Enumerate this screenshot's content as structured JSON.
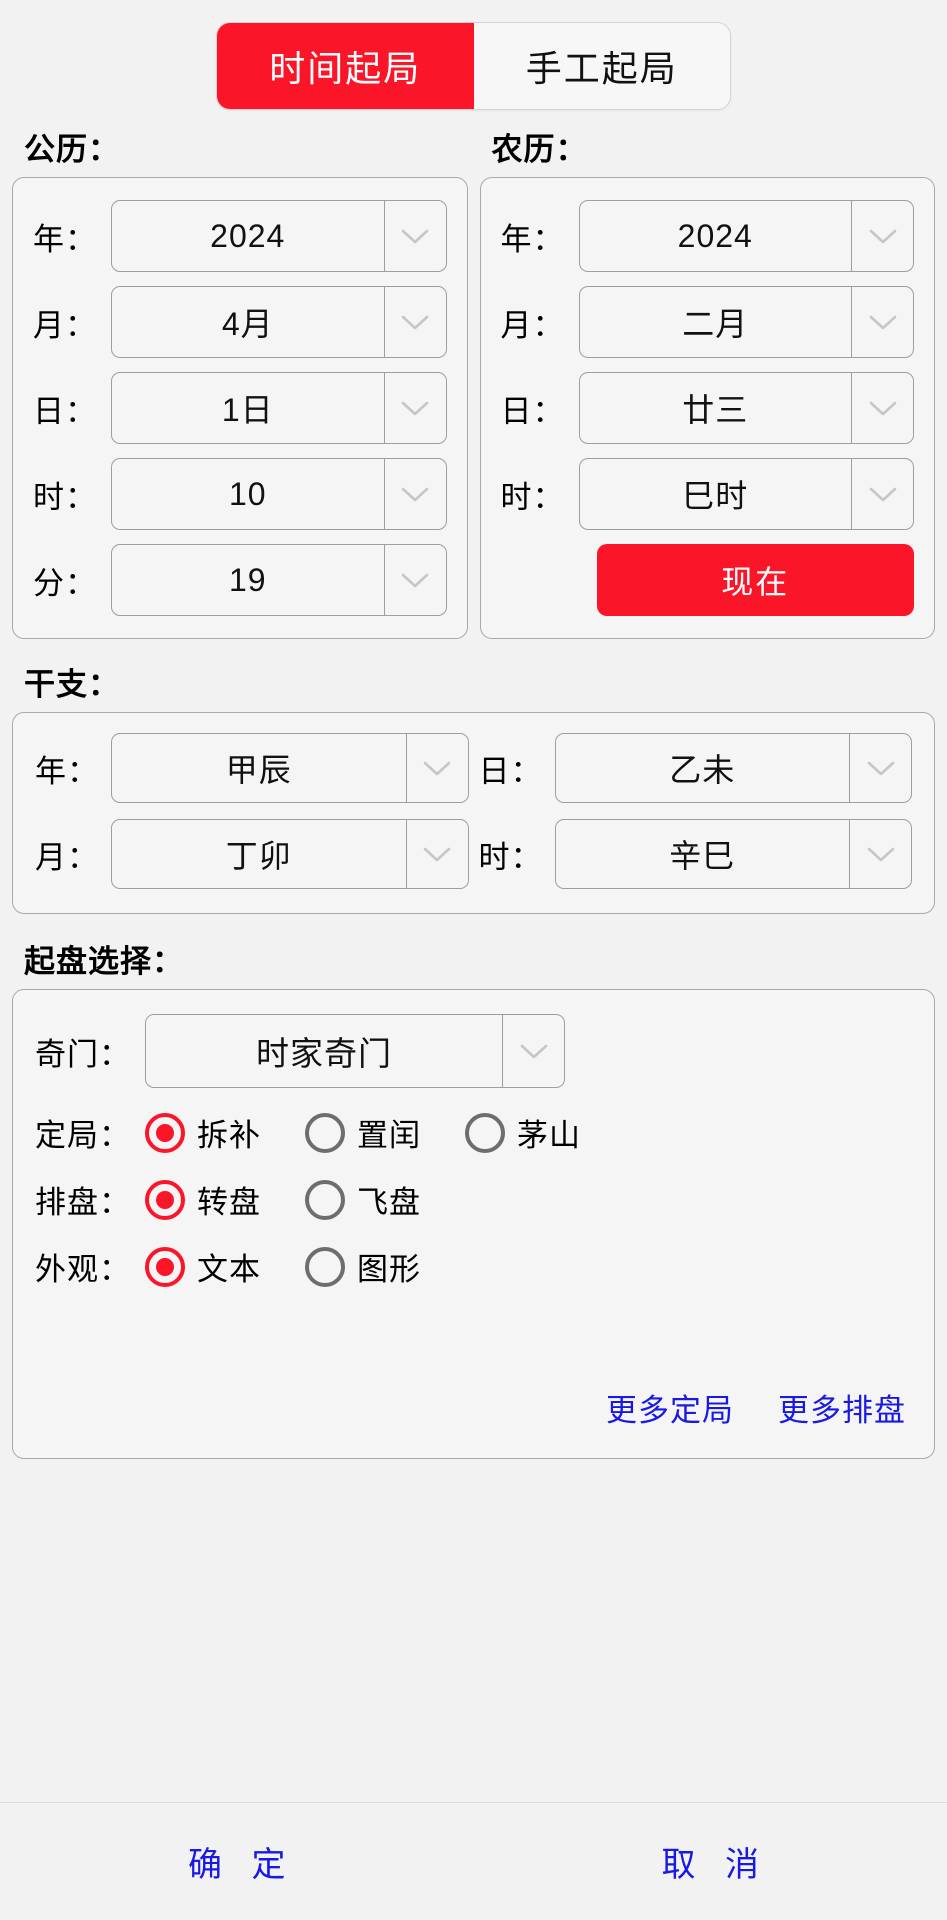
{
  "tabs": [
    {
      "label": "时间起局",
      "active": true
    },
    {
      "label": "手工起局",
      "active": false
    }
  ],
  "solar": {
    "title": "公历：",
    "fields": [
      {
        "label": "年：",
        "value": "2024"
      },
      {
        "label": "月：",
        "value": "4月"
      },
      {
        "label": "日：",
        "value": "1日"
      },
      {
        "label": "时：",
        "value": "10"
      },
      {
        "label": "分：",
        "value": "19"
      }
    ]
  },
  "lunar": {
    "title": "农历：",
    "fields": [
      {
        "label": "年：",
        "value": "2024"
      },
      {
        "label": "月：",
        "value": "二月"
      },
      {
        "label": "日：",
        "value": "廿三"
      },
      {
        "label": "时：",
        "value": "巳时"
      }
    ],
    "now_button": "现在"
  },
  "ganzhi": {
    "title": "干支：",
    "rows": [
      [
        {
          "label": "年：",
          "value": "甲辰"
        },
        {
          "label": "日：",
          "value": "乙未"
        }
      ],
      [
        {
          "label": "月：",
          "value": "丁卯"
        },
        {
          "label": "时：",
          "value": "辛巳"
        }
      ]
    ]
  },
  "plate": {
    "title": "起盘选择：",
    "qimen": {
      "label": "奇门：",
      "value": "时家奇门"
    },
    "radio_groups": [
      {
        "label": "定局：",
        "options": [
          {
            "text": "拆补",
            "checked": true
          },
          {
            "text": "置闰",
            "checked": false
          },
          {
            "text": "茅山",
            "checked": false
          }
        ]
      },
      {
        "label": "排盘：",
        "options": [
          {
            "text": "转盘",
            "checked": true
          },
          {
            "text": "飞盘",
            "checked": false
          }
        ]
      },
      {
        "label": "外观：",
        "options": [
          {
            "text": "文本",
            "checked": true
          },
          {
            "text": "图形",
            "checked": false
          }
        ]
      }
    ],
    "more_links": [
      {
        "text": "更多定局"
      },
      {
        "text": "更多排盘"
      }
    ]
  },
  "actions": [
    {
      "label": "确 定"
    },
    {
      "label": "取 消"
    }
  ],
  "colors": {
    "accent_red": "#fa1628",
    "link_blue": "#1919e6",
    "page_bg": "#f2f2f2",
    "border_gray": "#a9a9a9"
  },
  "icons": {
    "chevron_down": "chevron-down-icon"
  }
}
